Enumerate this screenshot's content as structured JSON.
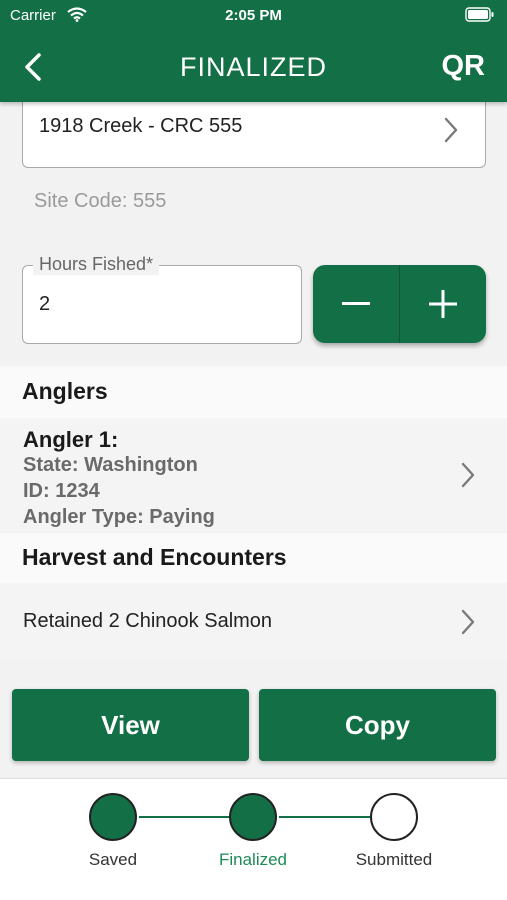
{
  "status_bar": {
    "carrier": "Carrier",
    "time": "2:05 PM"
  },
  "nav": {
    "title": "FINALIZED",
    "qr_label": "QR"
  },
  "site": {
    "selected": "1918 Creek - CRC 555",
    "site_code": "Site Code: 555"
  },
  "hours": {
    "label": "Hours Fished*",
    "value": "2"
  },
  "anglers": {
    "section_title": "Anglers",
    "items": [
      {
        "name": "Angler 1:",
        "state": "State: Washington",
        "id": "ID: 1234",
        "type": "Angler Type: Paying"
      }
    ]
  },
  "harvest": {
    "section_title": "Harvest and Encounters",
    "items": [
      {
        "text": "Retained 2 Chinook Salmon"
      }
    ]
  },
  "actions": {
    "view_label": "View",
    "copy_label": "Copy"
  },
  "progress": {
    "steps": [
      {
        "label": "Saved",
        "state": "done"
      },
      {
        "label": "Finalized",
        "state": "done"
      },
      {
        "label": "Submitted",
        "state": "todo"
      }
    ],
    "active_step": "Finalized"
  },
  "colors": {
    "brand_green": "#137046",
    "active_label": "#1f8a55"
  }
}
